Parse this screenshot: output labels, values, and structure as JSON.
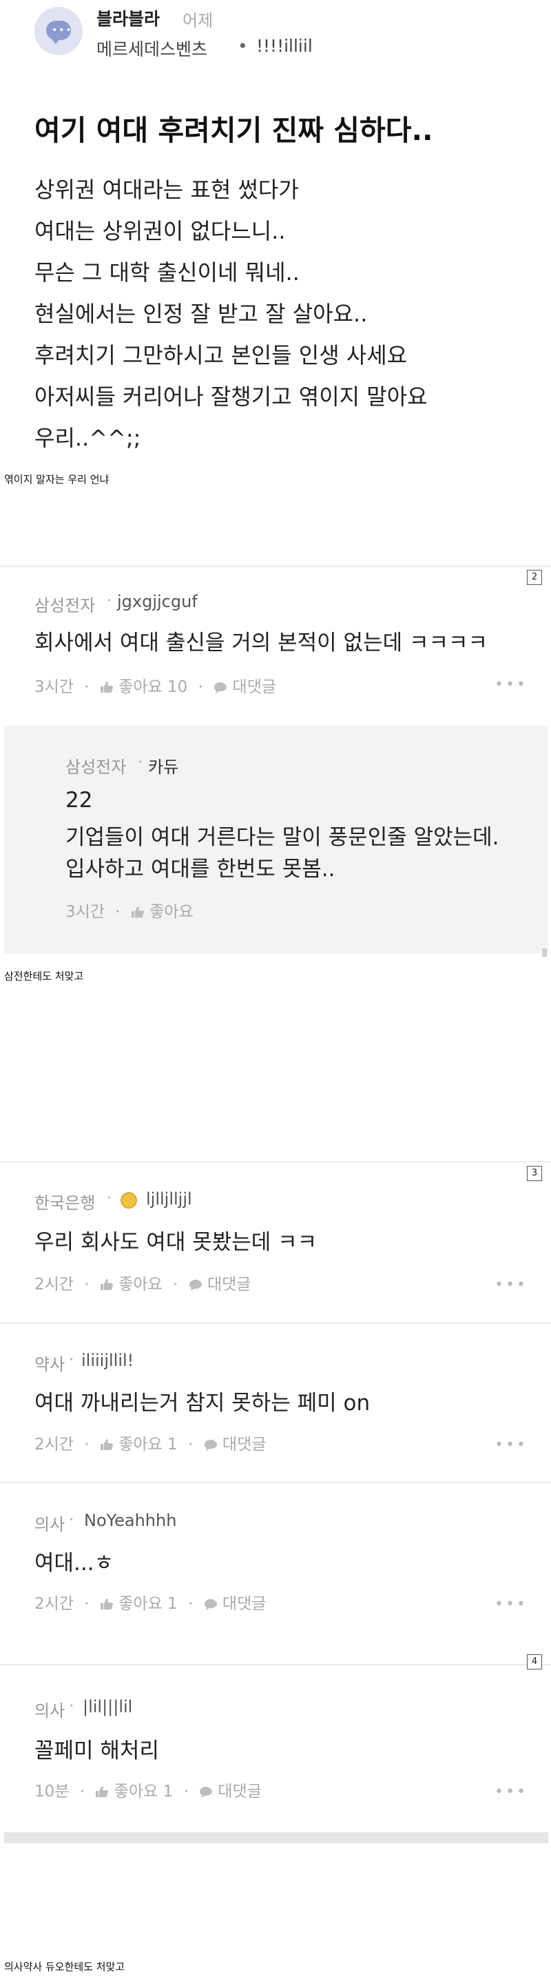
{
  "post": {
    "board": "블라블라",
    "time": "어제",
    "company": "메르세데스벤츠",
    "separator": "•",
    "nickname": "!!!!illiil",
    "title": "여기 여대 후려치기 진짜 심하다..",
    "lines": [
      "상위권 여대라는 표현 썼다가",
      "여대는 상위권이 없다느니..",
      "무슨 그 대학 출신이네 뭐네..",
      "현실에서는 인정 잘 받고 잘 살아요..",
      "후려치기 그만하시고 본인들 인생 사세요",
      "아저씨들 커리어나 잘챙기고 엮이지 말아요",
      "우리..^^;;"
    ]
  },
  "captions": [
    "엮이지 말자는 우리 언냐",
    "삼전한테도 처맞고",
    "의사약사 듀오한테도 처맞고"
  ],
  "pages": [
    "2",
    "3",
    "4"
  ],
  "comments": [
    {
      "company": "삼성전자",
      "user": "jgxgjjcguf",
      "text": "회사에서 여대 출신을 거의 본적이 없는데 ㅋㅋㅋㅋ",
      "time": "3시간",
      "like": "좋아요 10",
      "reply": "대댓글"
    },
    {
      "company": "삼성전자",
      "user": "카듀",
      "text_lines": [
        "22",
        "기업들이 여대 거른다는 말이 풍문인줄 알았는데.",
        "입사하고 여대를 한번도 못봄.."
      ],
      "time": "3시간",
      "like": "좋아요"
    },
    {
      "company": "한국은행",
      "user": "ljlljlljjl",
      "text": "우리 회사도 여대 못봤는데 ㅋㅋ",
      "time": "2시간",
      "like": "좋아요",
      "reply": "대댓글"
    },
    {
      "company": "약사",
      "user": "iliiijllil!",
      "text": "여대 까내리는거 참지 못하는 페미 on",
      "time": "2시간",
      "like": "좋아요 1",
      "reply": "대댓글"
    },
    {
      "company": "의사",
      "user": "NoYeahhhh",
      "text": "여대...ㅎ",
      "time": "2시간",
      "like": "좋아요 1",
      "reply": "대댓글"
    },
    {
      "company": "의사",
      "user": "|lil|||lil",
      "text": "꼴페미 해처리",
      "time": "10분",
      "like": "좋아요 1",
      "reply": "대댓글"
    }
  ],
  "separators": {
    "dot": "·"
  },
  "icons": [
    "avatar-chat-icon",
    "thumbs-up-icon",
    "comment-bubble-icon",
    "more-dots-icon",
    "gold-badge-icon"
  ]
}
